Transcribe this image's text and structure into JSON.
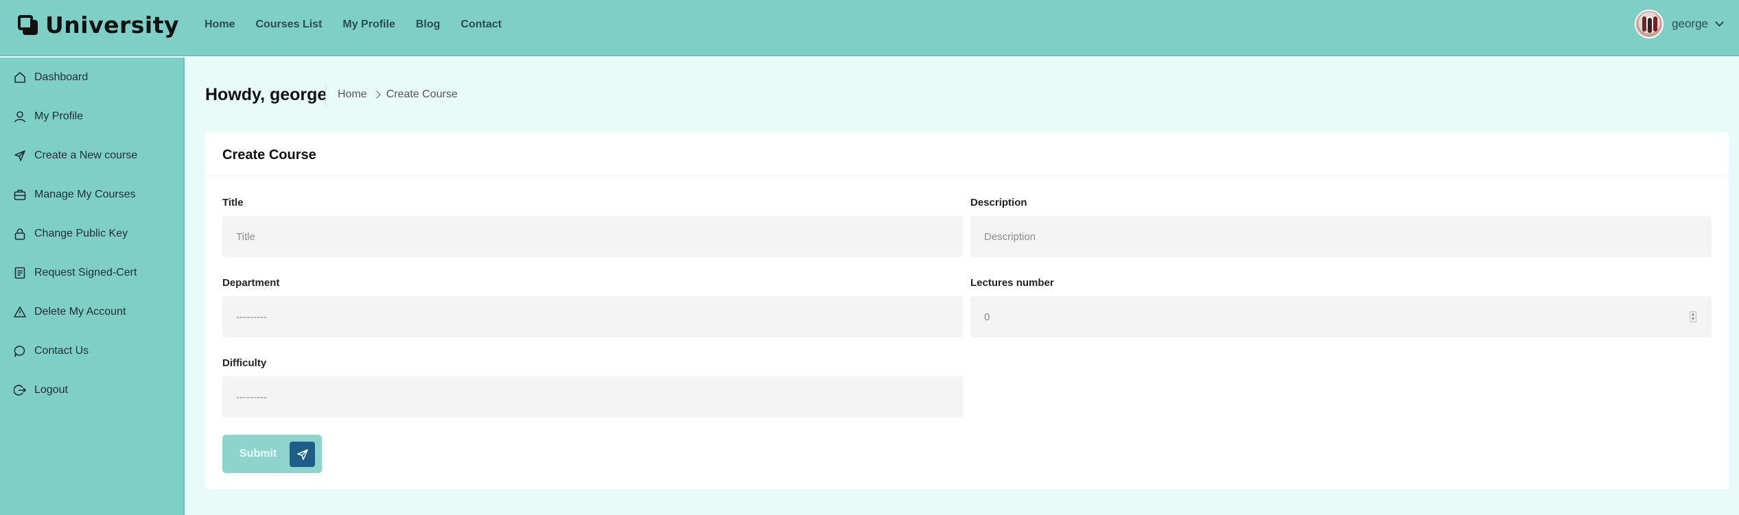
{
  "brand": {
    "name": "University"
  },
  "topnav": {
    "items": [
      {
        "label": "Home"
      },
      {
        "label": "Courses List"
      },
      {
        "label": "My Profile"
      },
      {
        "label": "Blog"
      },
      {
        "label": "Contact"
      }
    ]
  },
  "user": {
    "name": "george"
  },
  "sidebar": {
    "items": [
      {
        "label": "Dashboard",
        "icon": "home-icon"
      },
      {
        "label": "My Profile",
        "icon": "user-icon"
      },
      {
        "label": "Create a New course",
        "icon": "send-icon"
      },
      {
        "label": "Manage My Courses",
        "icon": "briefcase-icon"
      },
      {
        "label": "Change Public Key",
        "icon": "lock-icon"
      },
      {
        "label": "Request Signed-Cert",
        "icon": "document-icon"
      },
      {
        "label": "Delete My Account",
        "icon": "warning-icon"
      },
      {
        "label": "Contact Us",
        "icon": "chat-icon"
      },
      {
        "label": "Logout",
        "icon": "logout-icon"
      }
    ]
  },
  "header": {
    "greeting": "Howdy, george",
    "breadcrumb": [
      "Home",
      "Create Course"
    ]
  },
  "form": {
    "title": "Create Course",
    "fields": {
      "title": {
        "label": "Title",
        "placeholder": "Title",
        "value": ""
      },
      "description": {
        "label": "Description",
        "placeholder": "Description",
        "value": ""
      },
      "department": {
        "label": "Department",
        "selected": "---------"
      },
      "lectures": {
        "label": "Lectures number",
        "value": "0"
      },
      "difficulty": {
        "label": "Difficulty",
        "selected": "---------"
      }
    },
    "submit_label": "Submit"
  },
  "colors": {
    "header_bg": "#7ed0c6",
    "sidebar_bg": "#7ed0c6",
    "page_bg": "#e9fbf9",
    "submit_bg": "#8fd4cc",
    "submit_icon_bg": "#1d5d86"
  }
}
